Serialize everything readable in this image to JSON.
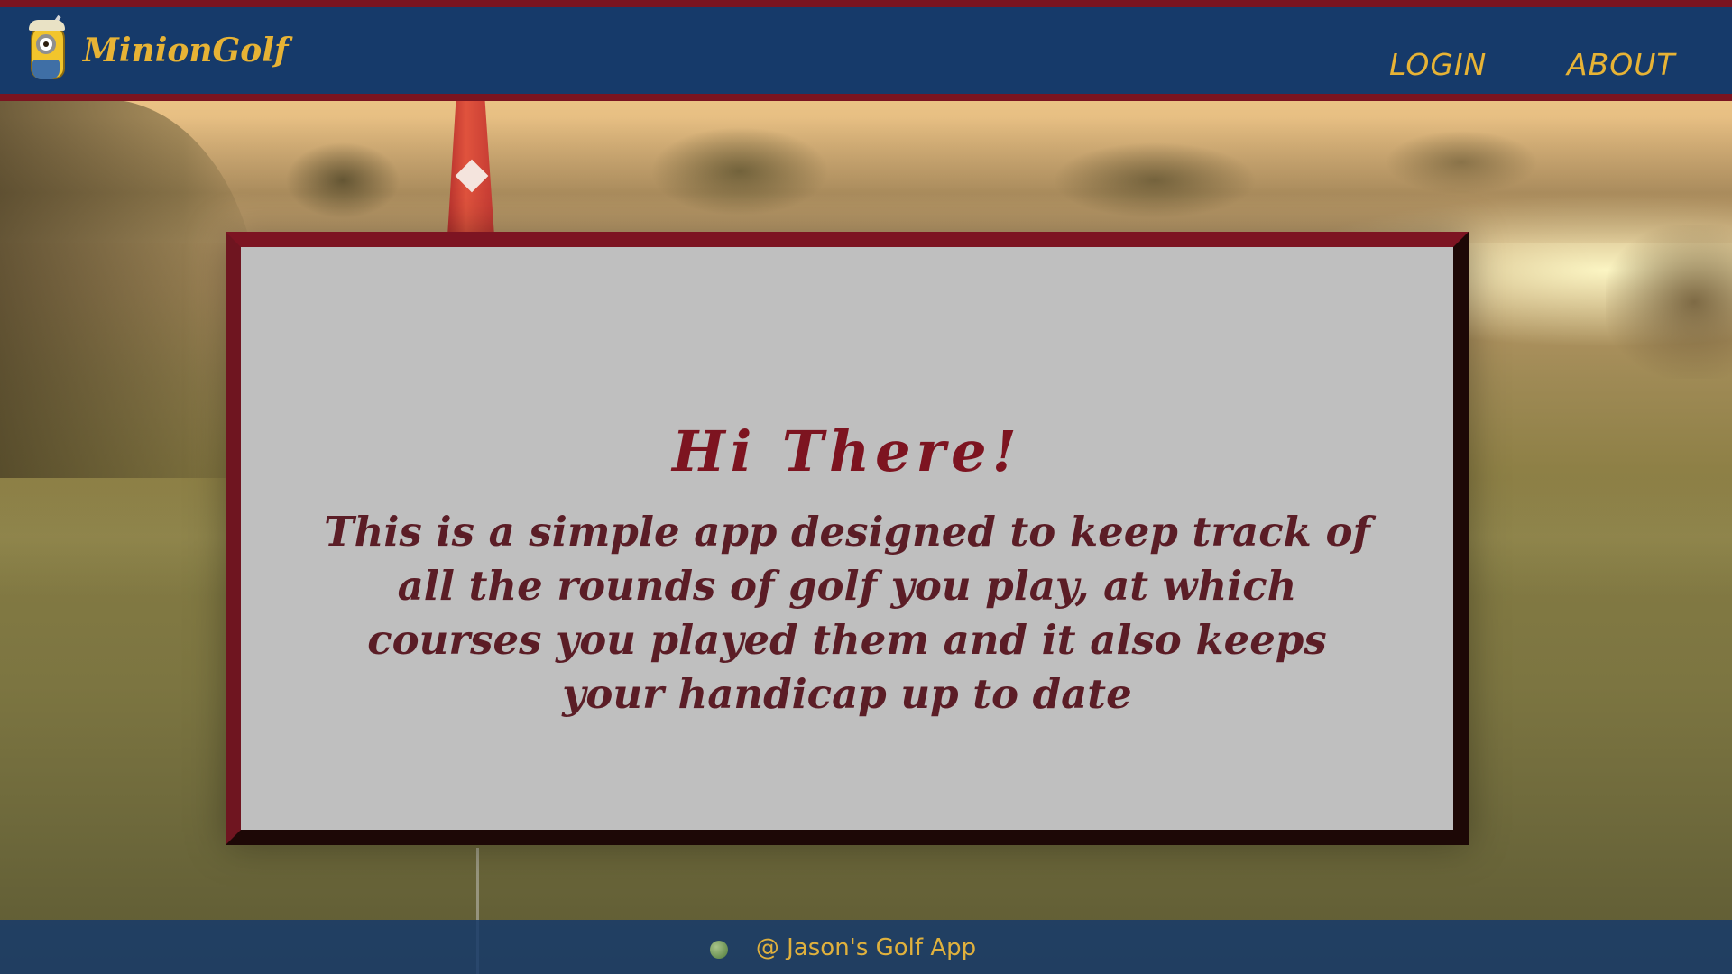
{
  "header": {
    "logo_text": "MinionGolf",
    "logo_icon": "minion-golfer-icon",
    "nav": {
      "login": "LOGIN",
      "about": "ABOUT"
    }
  },
  "main": {
    "title": "Hi There!",
    "description": "This is a simple app designed to keep track of all the rounds of golf you play, at which courses you played them and it also keeps your handicap up to date"
  },
  "footer": {
    "text": "@ Jason's Golf App"
  },
  "colors": {
    "header_bg": "#163a6a",
    "accent_maroon": "#7a1420",
    "gold": "#e7b335",
    "card_bg": "#bfbfbf"
  }
}
